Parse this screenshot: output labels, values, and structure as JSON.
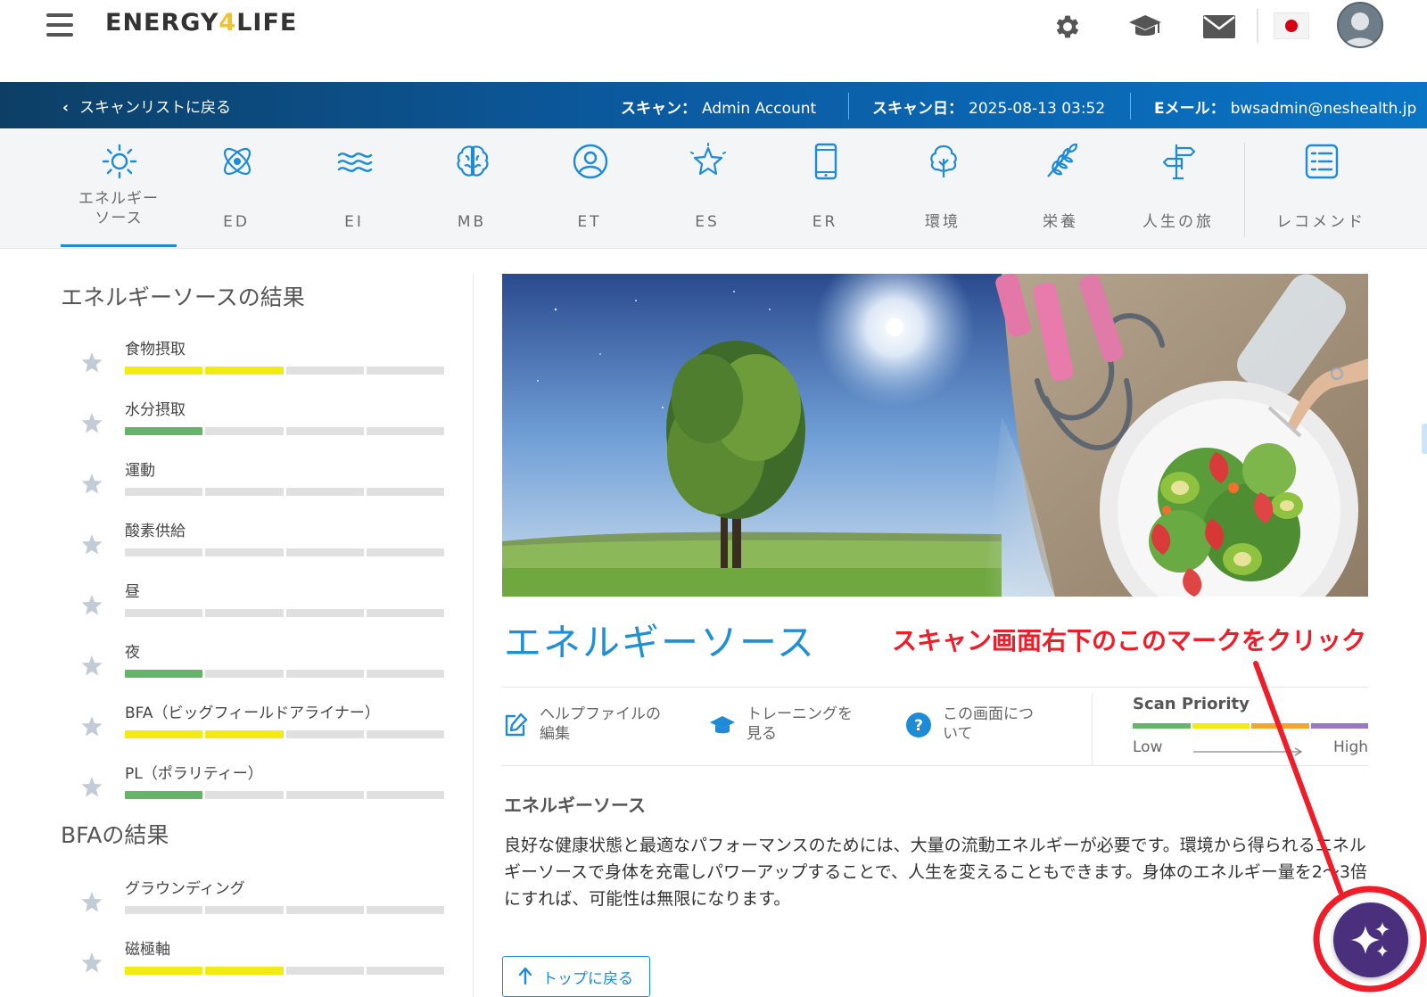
{
  "header": {
    "logo_prefix": "ENERGY",
    "logo_four": "4",
    "logo_suffix": "LIFE"
  },
  "scanbar": {
    "back_label": "スキャンリストに戻る",
    "scan_label": "スキャン：",
    "scan_value": "Admin Account",
    "date_label": "スキャン日：",
    "date_value": "2025-08-13 03:52",
    "email_label": "Eメール：",
    "email_value": "bwsadmin@neshealth.jp"
  },
  "tabs": [
    {
      "label": "エネルギー\nソース",
      "icon": "sun-icon"
    },
    {
      "label": "ED",
      "icon": "atom-icon"
    },
    {
      "label": "EI",
      "icon": "waves-icon"
    },
    {
      "label": "MB",
      "icon": "brain-icon"
    },
    {
      "label": "ET",
      "icon": "person-circle-icon"
    },
    {
      "label": "ES",
      "icon": "star-outline-icon"
    },
    {
      "label": "ER",
      "icon": "phone-icon"
    },
    {
      "label": "環境",
      "icon": "tree-icon"
    },
    {
      "label": "栄養",
      "icon": "wheat-icon"
    },
    {
      "label": "人生の旅",
      "icon": "signpost-icon"
    },
    {
      "label": "レコメンド",
      "icon": "list-icon"
    }
  ],
  "left": {
    "energy_title": "エネルギーソースの結果",
    "energy_items": [
      {
        "label": "食物摂取",
        "level": 2,
        "color": "#f2ea13"
      },
      {
        "label": "水分摂取",
        "level": 1,
        "color": "#66b36a"
      },
      {
        "label": "運動",
        "level": 0,
        "color": "#e0e0e0"
      },
      {
        "label": "酸素供給",
        "level": 0,
        "color": "#e0e0e0"
      },
      {
        "label": "昼",
        "level": 0,
        "color": "#e0e0e0"
      },
      {
        "label": "夜",
        "level": 1,
        "color": "#66b36a"
      },
      {
        "label": "BFA（ビッグフィールドアライナー）",
        "level": 2,
        "color": "#f2ea13"
      },
      {
        "label": "PL（ポラリティー）",
        "level": 1,
        "color": "#66b36a"
      }
    ],
    "bfa_title": "BFAの結果",
    "bfa_items": [
      {
        "label": "グラウンディング",
        "level": 0,
        "color": "#e0e0e0"
      },
      {
        "label": "磁極軸",
        "level": 2,
        "color": "#f2ea13"
      }
    ]
  },
  "main": {
    "heading": "エネルギーソース",
    "annotation": "スキャン画面右下のこのマークをクリック",
    "actions": [
      {
        "label": "ヘルプファイルの\n編集",
        "icon": "edit-icon"
      },
      {
        "label": "トレーニングを\n見る",
        "icon": "graduation-cap-icon"
      },
      {
        "label": "この画面につ\nいて",
        "icon": "help-circle-icon"
      }
    ],
    "priority": {
      "title": "Scan Priority",
      "low": "Low",
      "high": "High",
      "colors": [
        "#66b36a",
        "#f2ea13",
        "#f4a52f",
        "#9b79c2"
      ]
    },
    "section_title": "エネルギーソース",
    "section_text": "良好な健康状態と最適なパフォーマンスのためには、大量の流動エネルギーが必要です。環境から得られるエネルギーソースで身体を充電しパワーアップすることで、人生を変えることもできます。身体のエネルギー量を2〜3倍にすれば、可能性は無限になります。",
    "top_button": "トップに戻る"
  }
}
